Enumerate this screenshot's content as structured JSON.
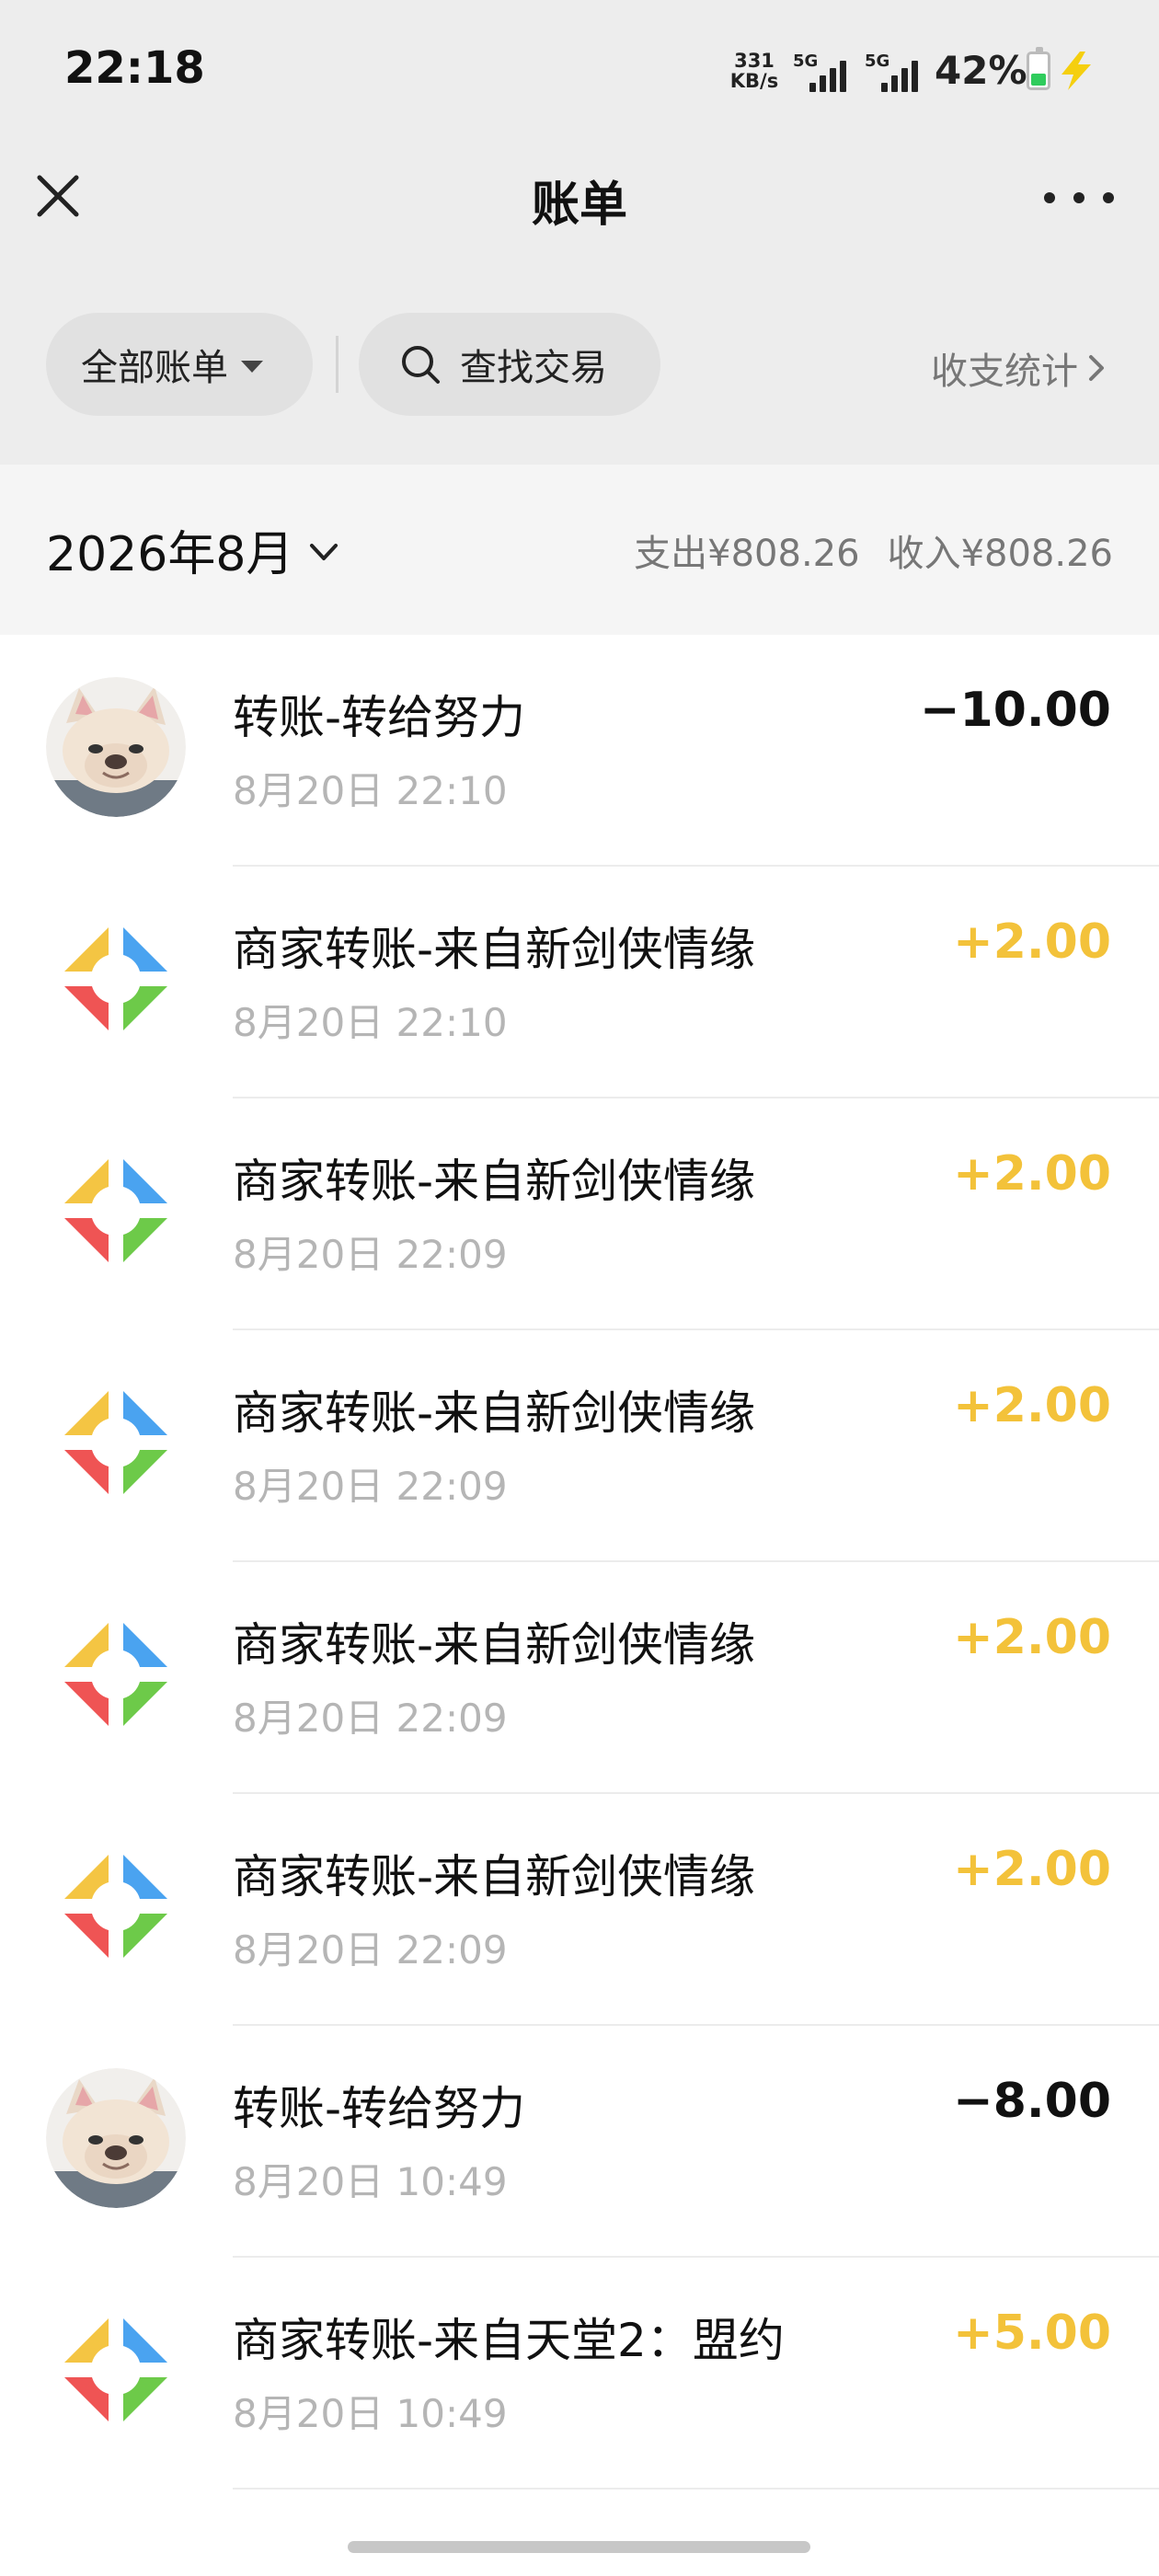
{
  "status_bar": {
    "time": "22:18",
    "net_speed_value": "331",
    "net_speed_unit": "KB/s",
    "signal1_label": "5G",
    "signal2_label": "5G",
    "battery_percent": "42%",
    "battery_level": 0.42,
    "battery_color": "#2fcc5c",
    "charging_color": "#f5cf0f"
  },
  "nav": {
    "title": "账单",
    "close_icon": "close-icon",
    "more_icon": "more-horizontal-icon"
  },
  "filters": {
    "all_bills_label": "全部账单",
    "search_label": "查找交易",
    "stats_label": "收支统计"
  },
  "summary": {
    "month": "2026年8月",
    "expense": "支出¥808.26",
    "income": "收入¥808.26"
  },
  "colors": {
    "income": "#f3c23a",
    "expense": "#111111",
    "top_background": "#ededed",
    "month_bar_background": "#f5f5f5"
  },
  "transactions": [
    {
      "title": "转账-转给努力",
      "time": "8月20日 22:10",
      "amount": "−10.00",
      "kind": "expense",
      "avatar": "dog-avatar"
    },
    {
      "title": "商家转账-来自新剑侠情缘",
      "time": "8月20日 22:10",
      "amount": "+2.00",
      "kind": "income",
      "avatar": "merchant-logo"
    },
    {
      "title": "商家转账-来自新剑侠情缘",
      "time": "8月20日 22:09",
      "amount": "+2.00",
      "kind": "income",
      "avatar": "merchant-logo"
    },
    {
      "title": "商家转账-来自新剑侠情缘",
      "time": "8月20日 22:09",
      "amount": "+2.00",
      "kind": "income",
      "avatar": "merchant-logo"
    },
    {
      "title": "商家转账-来自新剑侠情缘",
      "time": "8月20日 22:09",
      "amount": "+2.00",
      "kind": "income",
      "avatar": "merchant-logo"
    },
    {
      "title": "商家转账-来自新剑侠情缘",
      "time": "8月20日 22:09",
      "amount": "+2.00",
      "kind": "income",
      "avatar": "merchant-logo"
    },
    {
      "title": "转账-转给努力",
      "time": "8月20日 10:49",
      "amount": "−8.00",
      "kind": "expense",
      "avatar": "dog-avatar"
    },
    {
      "title": "商家转账-来自天堂2：盟约",
      "time": "8月20日 10:49",
      "amount": "+5.00",
      "kind": "income",
      "avatar": "merchant-logo"
    }
  ]
}
